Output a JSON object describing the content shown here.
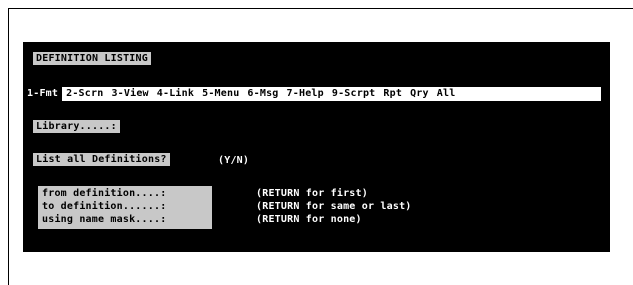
{
  "screen": {
    "title": "DEFINITION LISTING",
    "tabs": [
      {
        "label": "1-Fmt",
        "active": true
      },
      {
        "label": "2-Scrn",
        "active": false
      },
      {
        "label": "3-View",
        "active": false
      },
      {
        "label": "4-Link",
        "active": false
      },
      {
        "label": "5-Menu",
        "active": false
      },
      {
        "label": "6-Msg",
        "active": false
      },
      {
        "label": "7-Help",
        "active": false
      },
      {
        "label": "9-Scrpt",
        "active": false
      },
      {
        "label": "Rpt",
        "active": false
      },
      {
        "label": "Qry",
        "active": false
      },
      {
        "label": "All",
        "active": false
      }
    ],
    "library_label": "Library.....:",
    "list_all_label": "List all Definitions?",
    "list_all_hint": "(Y/N)",
    "fields": [
      {
        "label": "from definition....:",
        "hint": "(RETURN for first)"
      },
      {
        "label": "to definition......:",
        "hint": "(RETURN for same or last)"
      },
      {
        "label": "using name mask....:",
        "hint": "(RETURN for none)"
      }
    ]
  },
  "colors": {
    "background": "#000000",
    "highlight": "#c8c8c8",
    "text": "#ffffff"
  }
}
